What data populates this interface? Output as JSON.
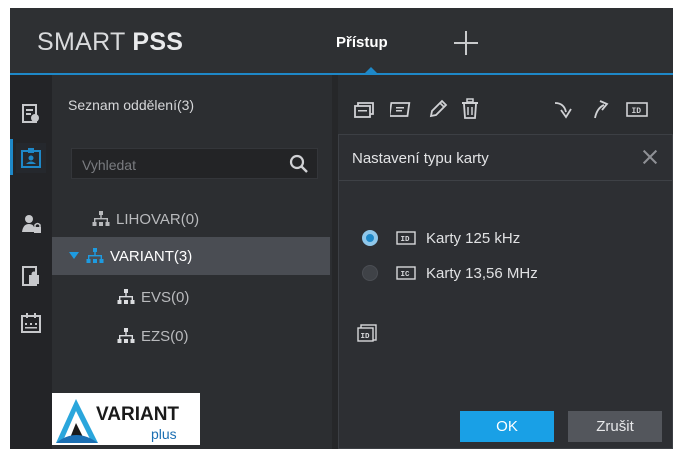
{
  "app": {
    "brand_light": "SMART ",
    "brand_bold": "PSS",
    "active_tab": "Přístup",
    "add_tab_icon": "plus-icon"
  },
  "sidebar": {
    "items": [
      {
        "icon": "person-document-icon",
        "active": false
      },
      {
        "icon": "id-card-icon",
        "active": true
      },
      {
        "icon": "user-lock-icon",
        "active": false
      },
      {
        "icon": "door-access-icon",
        "active": false
      },
      {
        "icon": "calendar-icon",
        "active": false
      }
    ]
  },
  "department_panel": {
    "title": "Seznam oddělení(3)",
    "search": {
      "placeholder": "Vyhledat",
      "value": ""
    },
    "tree": [
      {
        "label": "LIHOVAR(0)",
        "level": 0,
        "expanded": false,
        "selected": false
      },
      {
        "label": "VARIANT(3)",
        "level": 0,
        "expanded": true,
        "selected": true
      },
      {
        "label": "EVS(0)",
        "level": 1,
        "expanded": false,
        "selected": false
      },
      {
        "label": "EZS(0)",
        "level": 1,
        "expanded": false,
        "selected": false
      }
    ],
    "logo": {
      "name": "VARIANT",
      "sub": "plus"
    }
  },
  "toolbar": {
    "icons": [
      "batch-issue-icon",
      "card-icon",
      "edit-pencil-icon",
      "delete-trash-icon",
      "import-icon",
      "export-icon",
      "card-type-id-icon"
    ]
  },
  "dialog": {
    "title": "Nastavení typu karty",
    "options": [
      {
        "icon_label": "ID",
        "label": "Karty 125 kHz",
        "selected": true
      },
      {
        "icon_label": "IC",
        "label": "Karty 13,56 MHz",
        "selected": false
      }
    ],
    "ok_label": "OK",
    "cancel_label": "Zrušit"
  },
  "colors": {
    "accent": "#1e88c8",
    "ok_button": "#19a0e6",
    "background": "#2b2d30"
  }
}
